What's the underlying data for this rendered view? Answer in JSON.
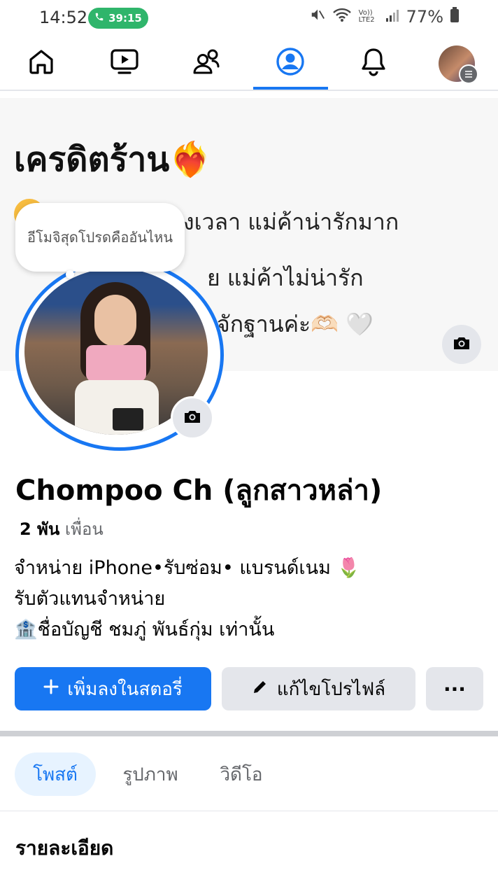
{
  "status_bar": {
    "time": "14:52",
    "call_timer": "39:15",
    "network": "Vo)) LTE2",
    "battery": "77%"
  },
  "nav": {
    "items": [
      "home",
      "video",
      "friends",
      "profile",
      "notifications",
      "menu"
    ],
    "active": "profile",
    "accent_color": "#1877f2"
  },
  "cover": {
    "title": "เครดิตร้าน❤️‍🔥",
    "lines": [
      "งเวลา แม่ค้าน่ารักมาก",
      "ย แม่ค้าไม่น่ารัก",
      "จักฐานค่ะ🫶🏻 🤍"
    ]
  },
  "profile_bubble": {
    "text": "อีโมจิสุดโปรดคืออันไหน"
  },
  "profile": {
    "name": "Chompoo Ch (ลูกสาวหล่า)",
    "friends_count": "2 พัน",
    "friends_label": "เพื่อน",
    "bio_lines": [
      "จำหน่าย iPhone•รับซ่อม• แบรนด์เนม 🌷",
      "รับตัวแทนจำหน่าย",
      "🏦ชื่อบัญชี ชมภู่ พันธ์กุ่ม เท่านั้น"
    ]
  },
  "actions": {
    "add_story": "เพิ่มลงในสตอรี่",
    "edit_profile": "แก้ไขโปรไฟล์",
    "more": "···"
  },
  "tabs": [
    "โพสต์",
    "รูปภาพ",
    "วิดีโอ"
  ],
  "section_title": "รายละเอียด"
}
